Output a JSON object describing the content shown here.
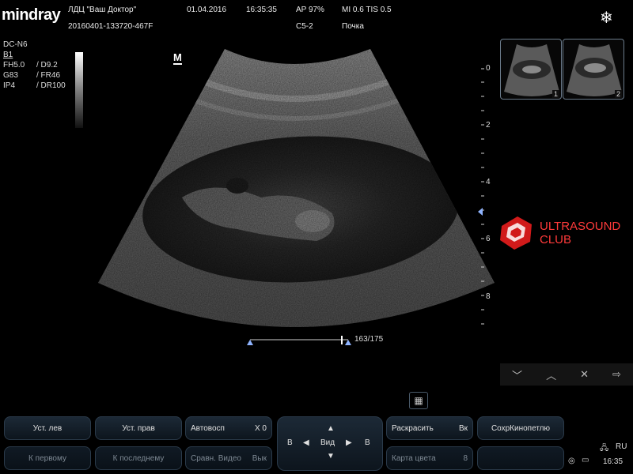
{
  "header": {
    "brand": "mindray",
    "clinic": "ЛДЦ \"Ваш Доктор\"",
    "patient_id": "20160401-133720-467F",
    "date": "01.04.2016",
    "time": "16:35:35",
    "ap": "AP  97%",
    "probe": "C5-2",
    "mi_tis": "MI 0.6  TIS 0.5",
    "exam": "Почка",
    "freeze_icon": "snowflake-icon"
  },
  "params": {
    "mode": "DC-N6",
    "mode_sub": "B1",
    "rows": [
      {
        "a": "FH5.0",
        "b": "/ D9.2"
      },
      {
        "a": "G83",
        "b": "/ FR46"
      },
      {
        "a": "IP4",
        "b": "/ DR100"
      }
    ],
    "marker": "M"
  },
  "depth_scale": [
    "0",
    "2",
    "4",
    "6",
    "8"
  ],
  "selection_label": "163/175",
  "watermark": {
    "line1": "ULTRASOUND",
    "line2": "CLUB",
    "color": "#ff3a3a"
  },
  "thumbnails": [
    {
      "num": "1"
    },
    {
      "num": "2"
    }
  ],
  "right_toolbar": {
    "down": "﹀",
    "up": "︿",
    "close": "✕",
    "export": "⇨"
  },
  "buttons": {
    "set_left": "Уст. лев",
    "set_right": "Уст. прав",
    "auto_play": "Автовосп",
    "auto_play_val": "X 0",
    "colorize": "Раскрасить",
    "colorize_val": "Вк",
    "save_cine": "СохрКинопетлю",
    "to_first": "К первому",
    "to_last": "К последнему",
    "compare": "Сравн. Видео",
    "compare_val": "Вык",
    "color_map": "Карта цвета",
    "color_map_val": "8"
  },
  "navpad": {
    "left": "B",
    "right": "B",
    "center": "Вид",
    "arrow_up": "▲",
    "arrow_down": "▼",
    "arrow_left": "◀",
    "arrow_right": "▶"
  },
  "status": {
    "lang": "RU",
    "clock": "16:35"
  }
}
